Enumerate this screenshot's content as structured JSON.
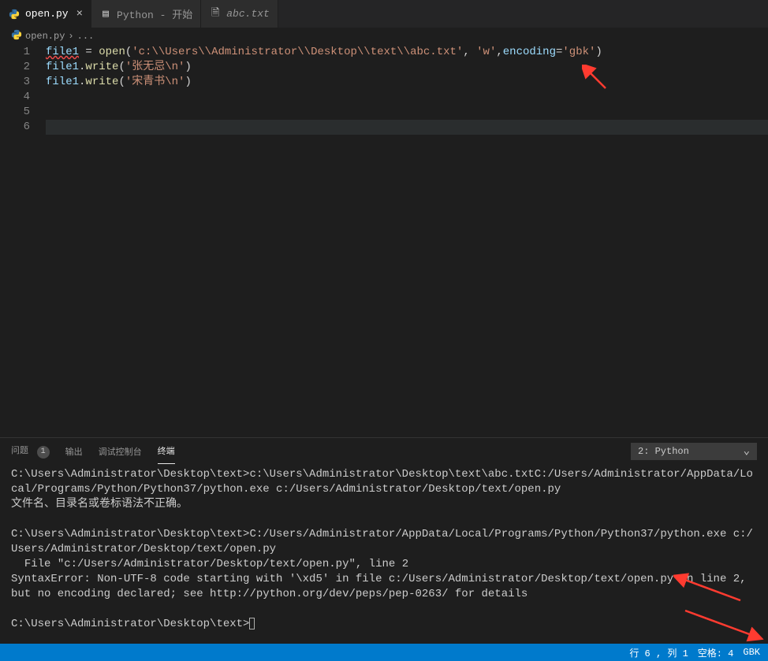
{
  "tabs": [
    {
      "label": "open.py",
      "icon": "python",
      "active": true,
      "close": "×"
    },
    {
      "label": "Python - 开始",
      "icon": "preview",
      "active": false
    },
    {
      "label": "abc.txt",
      "icon": "file",
      "active": false
    }
  ],
  "breadcrumb": {
    "file": "open.py",
    "sep": "›",
    "rest": "..."
  },
  "code": {
    "lines": [
      [
        {
          "t": "file1",
          "c": "tk-var"
        },
        {
          "t": " = ",
          "c": "tk-pun"
        },
        {
          "t": "open",
          "c": "tk-fn"
        },
        {
          "t": "(",
          "c": "tk-pun"
        },
        {
          "t": "'c:\\\\Users\\\\Administrator\\\\Desktop\\\\text\\\\abc.txt'",
          "c": "tk-str"
        },
        {
          "t": ", ",
          "c": "tk-pun"
        },
        {
          "t": "'w'",
          "c": "tk-str"
        },
        {
          "t": ",",
          "c": "tk-pun"
        },
        {
          "t": "encoding",
          "c": "tk-kw"
        },
        {
          "t": "=",
          "c": "tk-pun"
        },
        {
          "t": "'gbk'",
          "c": "tk-str"
        },
        {
          "t": ")",
          "c": "tk-pun"
        }
      ],
      [
        {
          "t": "file1",
          "c": "tk-var"
        },
        {
          "t": ".",
          "c": "tk-pun"
        },
        {
          "t": "write",
          "c": "tk-fn"
        },
        {
          "t": "(",
          "c": "tk-pun"
        },
        {
          "t": "'张无忌\\n'",
          "c": "tk-str"
        },
        {
          "t": ")",
          "c": "tk-pun"
        }
      ],
      [
        {
          "t": "file1",
          "c": "tk-var"
        },
        {
          "t": ".",
          "c": "tk-pun"
        },
        {
          "t": "write",
          "c": "tk-fn"
        },
        {
          "t": "(",
          "c": "tk-pun"
        },
        {
          "t": "'宋青书\\n'",
          "c": "tk-str"
        },
        {
          "t": ")",
          "c": "tk-pun"
        }
      ],
      [],
      [],
      []
    ],
    "lineNumbers": [
      "1",
      "2",
      "3",
      "4",
      "5",
      "6"
    ]
  },
  "panel": {
    "tabs": {
      "problems": "问题",
      "problemsCount": "1",
      "output": "输出",
      "debug": "调试控制台",
      "terminal": "终端"
    },
    "select": "2: Python",
    "terminal": "C:\\Users\\Administrator\\Desktop\\text>c:\\Users\\Administrator\\Desktop\\text\\abc.txtC:/Users/Administrator/AppData/Local/Programs/Python/Python37/python.exe c:/Users/Administrator/Desktop/text/open.py\n文件名、目录名或卷标语法不正确。\n\nC:\\Users\\Administrator\\Desktop\\text>C:/Users/Administrator/AppData/Local/Programs/Python/Python37/python.exe c:/Users/Administrator/Desktop/text/open.py\n  File \"c:/Users/Administrator/Desktop/text/open.py\", line 2\nSyntaxError: Non-UTF-8 code starting with '\\xd5' in file c:/Users/Administrator/Desktop/text/open.py on line 2, but no encoding declared; see http://python.org/dev/peps/pep-0263/ for details\n\nC:\\Users\\Administrator\\Desktop\\text>"
  },
  "status": {
    "line": "行 6 , 列 1",
    "spaces": "空格: 4",
    "encoding": "GBK"
  }
}
